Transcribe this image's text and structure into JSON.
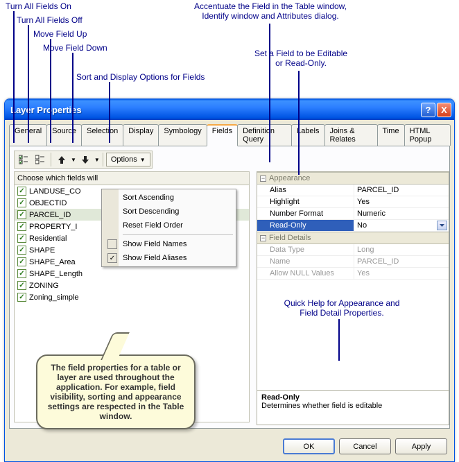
{
  "annotations": {
    "all_on": "Turn All Fields On",
    "all_off": "Turn All Fields Off",
    "move_up": "Move Field Up",
    "move_down": "Move Field Down",
    "sort_opts": "Sort and Display Options for Fields",
    "accentuate": "Accentuate the Field in the Table window,\nIdentify window and Attributes dialog.",
    "editable": "Set a Field to be Editable\nor Read-Only.",
    "help_anno": "Quick Help for Appearance and\nField Detail Properties."
  },
  "window": {
    "title": "Layer Properties",
    "help_glyph": "?",
    "close_glyph": "X"
  },
  "tabs": [
    "General",
    "Source",
    "Selection",
    "Display",
    "Symbology",
    "Fields",
    "Definition Query",
    "Labels",
    "Joins & Relates",
    "Time",
    "HTML Popup"
  ],
  "active_tab": "Fields",
  "toolbar": {
    "options_label": "Options"
  },
  "choose_label": "Choose which fields will",
  "fields": [
    {
      "name": "LANDUSE_CO",
      "checked": true
    },
    {
      "name": "OBJECTID",
      "checked": true
    },
    {
      "name": "PARCEL_ID",
      "checked": true,
      "selected": true
    },
    {
      "name": "PROPERTY_I",
      "checked": true
    },
    {
      "name": "Residential",
      "checked": true
    },
    {
      "name": "SHAPE",
      "checked": true
    },
    {
      "name": "SHAPE_Area",
      "checked": true
    },
    {
      "name": "SHAPE_Length",
      "checked": true
    },
    {
      "name": "ZONING",
      "checked": true
    },
    {
      "name": "Zoning_simple",
      "checked": true
    }
  ],
  "menu": {
    "sort_asc": "Sort Ascending",
    "sort_desc": "Sort Descending",
    "reset": "Reset Field Order",
    "show_names": "Show Field Names",
    "show_aliases": "Show Field Aliases"
  },
  "prop_groups": {
    "appearance": "Appearance",
    "details": "Field Details"
  },
  "props": {
    "alias": {
      "label": "Alias",
      "value": "PARCEL_ID"
    },
    "highlight": {
      "label": "Highlight",
      "value": "Yes"
    },
    "numfmt": {
      "label": "Number Format",
      "value": "Numeric"
    },
    "readonly": {
      "label": "Read-Only",
      "value": "No"
    },
    "datatype": {
      "label": "Data Type",
      "value": "Long"
    },
    "name": {
      "label": "Name",
      "value": "PARCEL_ID"
    },
    "allownull": {
      "label": "Allow NULL Values",
      "value": "Yes"
    }
  },
  "help": {
    "title": "Read-Only",
    "body": "Determines whether field is editable"
  },
  "callout": "The field properties for a table or layer are used throughout the application.  For example, field visibility, sorting and appearance settings are respected in the Table window.",
  "buttons": {
    "ok": "OK",
    "cancel": "Cancel",
    "apply": "Apply"
  }
}
